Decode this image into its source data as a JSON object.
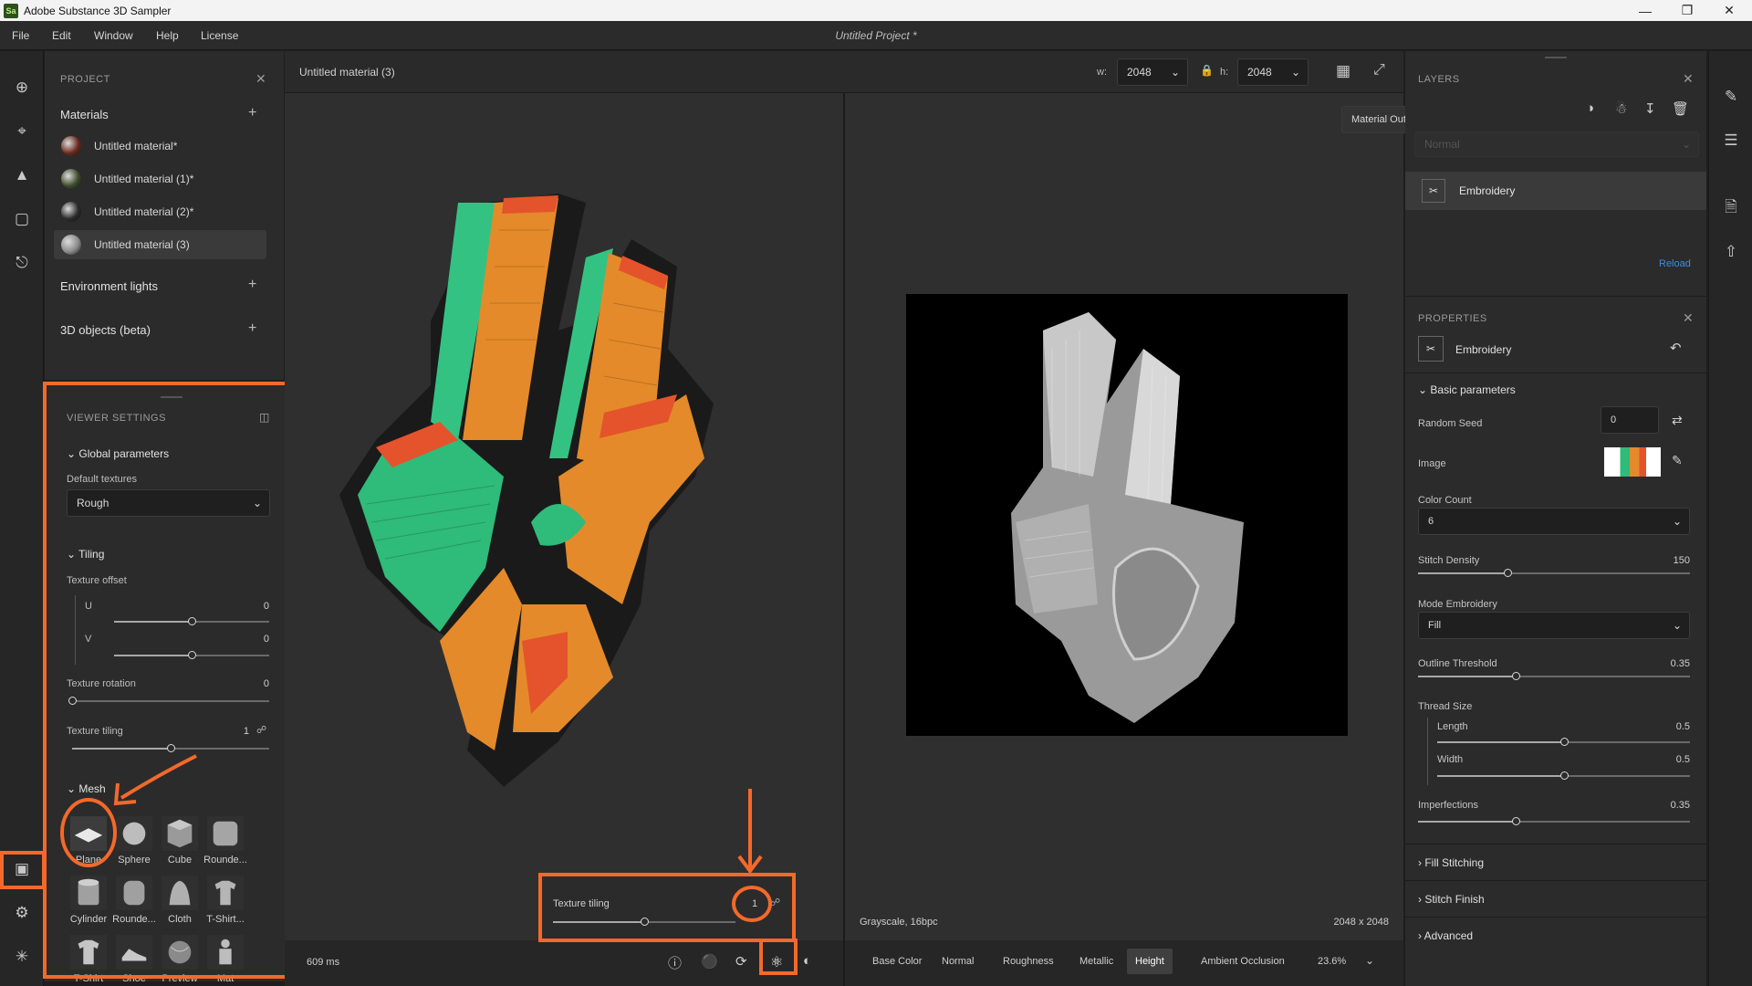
{
  "window": {
    "app_badge": "Sa",
    "title": "Adobe Substance 3D Sampler",
    "minimize_icon": "minimize-icon",
    "maximize_icon": "restore-icon",
    "close_icon": "close-icon"
  },
  "menu": {
    "items": [
      "File",
      "Edit",
      "Window",
      "Help",
      "License"
    ],
    "project_title": "Untitled Project *"
  },
  "project_panel": {
    "header": "PROJECT",
    "materials_title": "Materials",
    "materials": [
      {
        "label": "Untitled material*",
        "thumb_color": "#6b2a1e"
      },
      {
        "label": "Untitled material (1)*",
        "thumb_color": "#3d4a2a"
      },
      {
        "label": "Untitled material (2)*",
        "thumb_color": "#2a2a2a"
      },
      {
        "label": "Untitled material (3)",
        "thumb_color": "#8a8a8a",
        "selected": true
      }
    ],
    "environment_lights": "Environment lights",
    "objects": "3D objects (beta)"
  },
  "viewer_settings": {
    "header": "VIEWER SETTINGS",
    "global_parameters": "Global parameters",
    "default_textures_label": "Default textures",
    "default_textures_value": "Rough",
    "tiling_title": "Tiling",
    "texture_offset_label": "Texture offset",
    "u_label": "U",
    "u_value": "0",
    "u_fraction": 0.5,
    "v_label": "V",
    "v_value": "0",
    "v_fraction": 0.5,
    "rotation_label": "Texture rotation",
    "rotation_value": "0",
    "rotation_fraction": 0.0,
    "tiling_label": "Texture tiling",
    "tiling_value": "1",
    "tiling_fraction": 0.5,
    "mesh_title": "Mesh",
    "meshes": [
      {
        "label": "Plane",
        "icon": "plane-mesh-icon"
      },
      {
        "label": "Sphere",
        "icon": "sphere-mesh-icon"
      },
      {
        "label": "Cube",
        "icon": "cube-mesh-icon"
      },
      {
        "label": "Rounde...",
        "icon": "rounded-cube-mesh-icon"
      },
      {
        "label": "Cylinder",
        "icon": "cylinder-mesh-icon"
      },
      {
        "label": "Rounde...",
        "icon": "rounded-cylinder-mesh-icon"
      },
      {
        "label": "Cloth",
        "icon": "cloth-mesh-icon"
      },
      {
        "label": "T-Shirt...",
        "icon": "tshirt-mesh-icon"
      },
      {
        "label": "T-Shirt",
        "icon": "tshirt2-mesh-icon"
      },
      {
        "label": "Shoe",
        "icon": "shoe-mesh-icon"
      },
      {
        "label": "Preview",
        "icon": "preview-mesh-icon"
      },
      {
        "label": "Mat",
        "icon": "mat-mesh-icon"
      }
    ]
  },
  "viewport": {
    "material_name": "Untitled material (3)",
    "w_label": "w:",
    "w_value": "2048",
    "h_label": "h:",
    "h_value": "2048",
    "material_outputs": "Material Outputs",
    "render_time": "609 ms",
    "format": "Grayscale, 16bpc",
    "resolution": "2048 x 2048",
    "zoom": "23.6%",
    "channels": [
      "Base Color",
      "Normal",
      "Roughness",
      "Metallic",
      "Height",
      "Ambient Occlusion"
    ],
    "active_channel": "Height"
  },
  "tiling_popup": {
    "label": "Texture tiling",
    "value": "1",
    "fraction": 0.5
  },
  "layers_panel": {
    "header": "LAYERS",
    "blend_mode": "Normal",
    "layer_name": "Embroidery",
    "reload": "Reload"
  },
  "properties": {
    "header": "PROPERTIES",
    "filter_name": "Embroidery",
    "basic_parameters": "Basic parameters",
    "random_seed_label": "Random Seed",
    "random_seed_value": "0",
    "image_label": "Image",
    "color_count_label": "Color Count",
    "color_count_value": "6",
    "stitch_density_label": "Stitch Density",
    "stitch_density_value": "150",
    "stitch_density_fraction": 0.33,
    "mode_label": "Mode Embroidery",
    "mode_value": "Fill",
    "outline_label": "Outline Threshold",
    "outline_value": "0.35",
    "outline_fraction": 0.36,
    "thread_size_label": "Thread Size",
    "length_label": "Length",
    "length_value": "0.5",
    "length_fraction": 0.5,
    "width_label": "Width",
    "width_value": "0.5",
    "width_fraction": 0.5,
    "imperfections_label": "Imperfections",
    "imperfections_value": "0.35",
    "imperfections_fraction": 0.36,
    "fill_stitching": "Fill Stitching",
    "stitch_finish": "Stitch Finish",
    "advanced": "Advanced"
  },
  "colors": {
    "accent_orange": "#f4692a",
    "link_blue": "#3d8ee0"
  }
}
